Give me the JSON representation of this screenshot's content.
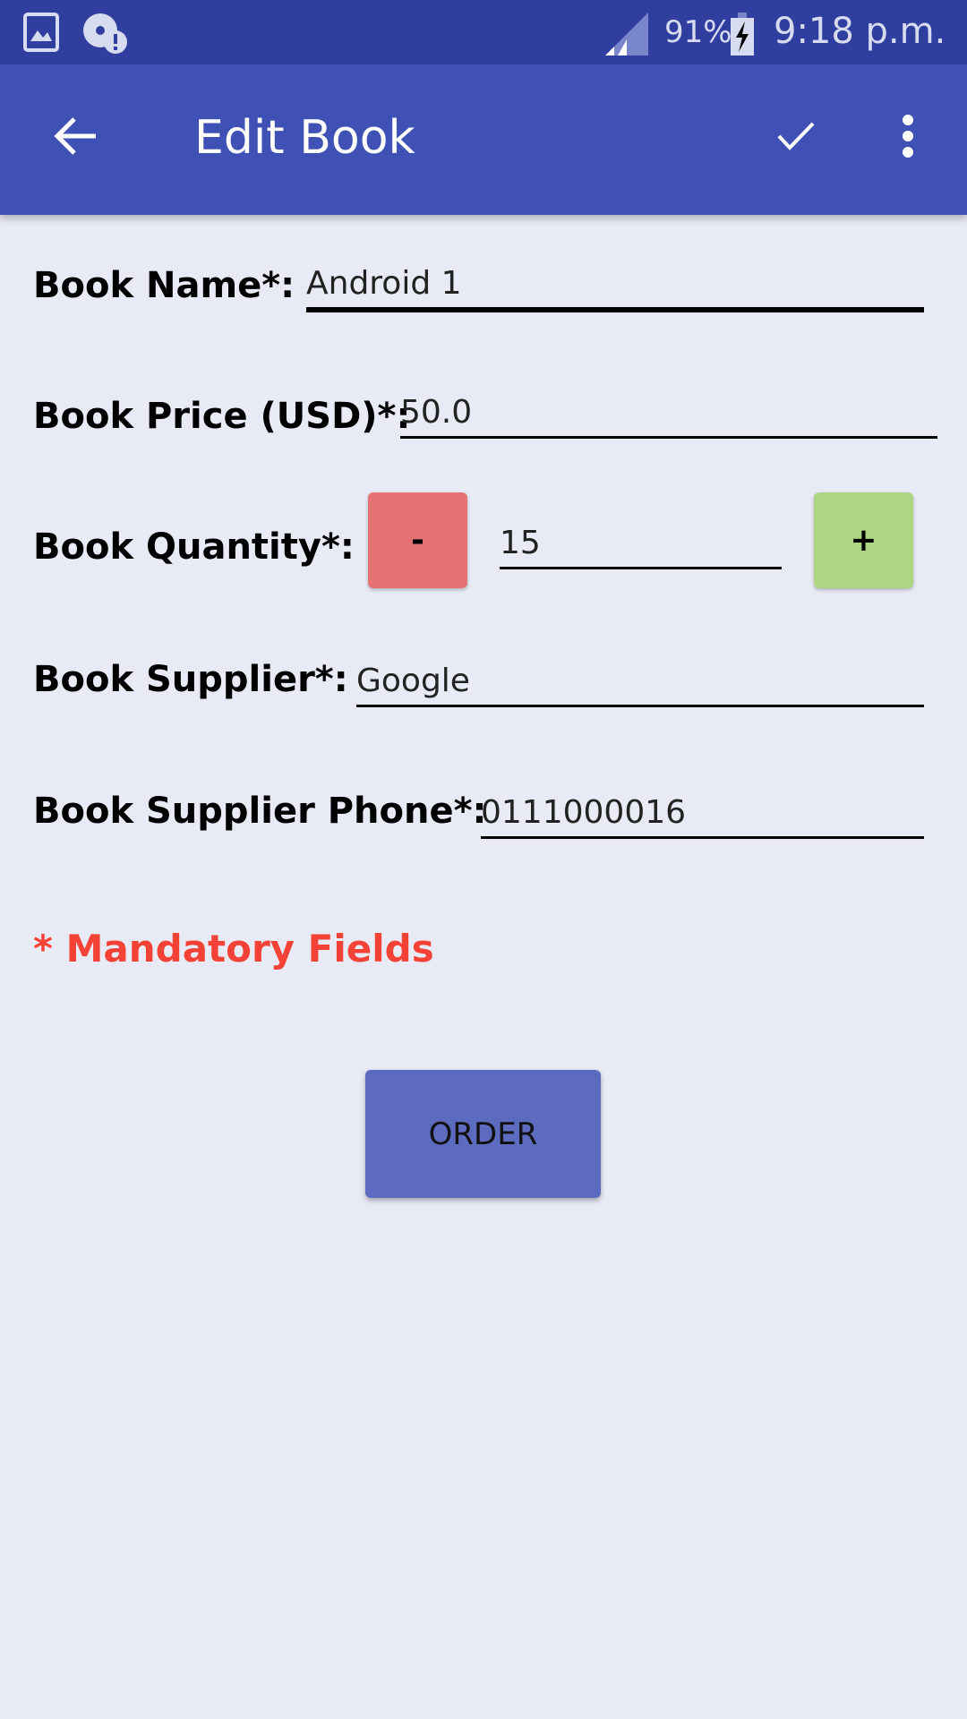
{
  "status_bar": {
    "battery": "91%",
    "time": "9:18 p.m."
  },
  "toolbar": {
    "title": "Edit Book"
  },
  "form": {
    "name_label": "Book Name*:",
    "name_value": "Android 1",
    "price_label": "Book Price (USD)*:",
    "price_value": "50.0",
    "quantity_label": "Book Quantity*:",
    "quantity_value": "15",
    "minus": "-",
    "plus": "+",
    "supplier_label": "Book Supplier*:",
    "supplier_value": "Google",
    "phone_label": "Book Supplier Phone*:",
    "phone_value": "0111000016"
  },
  "mandatory_note": "* Mandatory Fields",
  "order_label": "ORDER",
  "colors": {
    "primary": "#3F51B5",
    "primary_dark": "#303F9F",
    "minus": "#E57373",
    "plus": "#AED581",
    "mandatory": "#F44336",
    "button": "#5C6BC0"
  }
}
